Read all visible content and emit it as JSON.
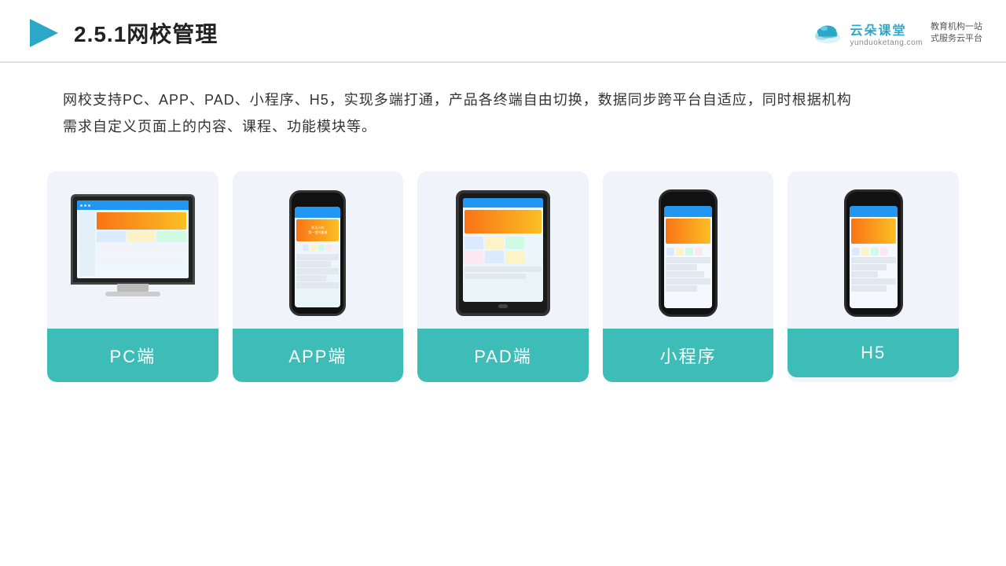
{
  "header": {
    "title": "2.5.1网校管理",
    "brand_name": "云朵课堂",
    "brand_url": "yunduoketang.com",
    "brand_tagline_line1": "教育机构一站",
    "brand_tagline_line2": "式服务云平台"
  },
  "description": {
    "text_line1": "网校支持PC、APP、PAD、小程序、H5，实现多端打通，产品各终端自由切换，数据同步跨平台自适应，同时根据机构",
    "text_line2": "需求自定义页面上的内容、课程、功能模块等。"
  },
  "cards": [
    {
      "label": "PC端",
      "device": "monitor"
    },
    {
      "label": "APP端",
      "device": "phone"
    },
    {
      "label": "PAD端",
      "device": "tablet"
    },
    {
      "label": "小程序",
      "device": "mini-phone"
    },
    {
      "label": "H5",
      "device": "h5-phone"
    }
  ],
  "colors": {
    "teal": "#3dbcb8",
    "accent_orange": "#f97316",
    "accent_blue": "#2196F3",
    "bg_card": "#f0f4fa"
  }
}
